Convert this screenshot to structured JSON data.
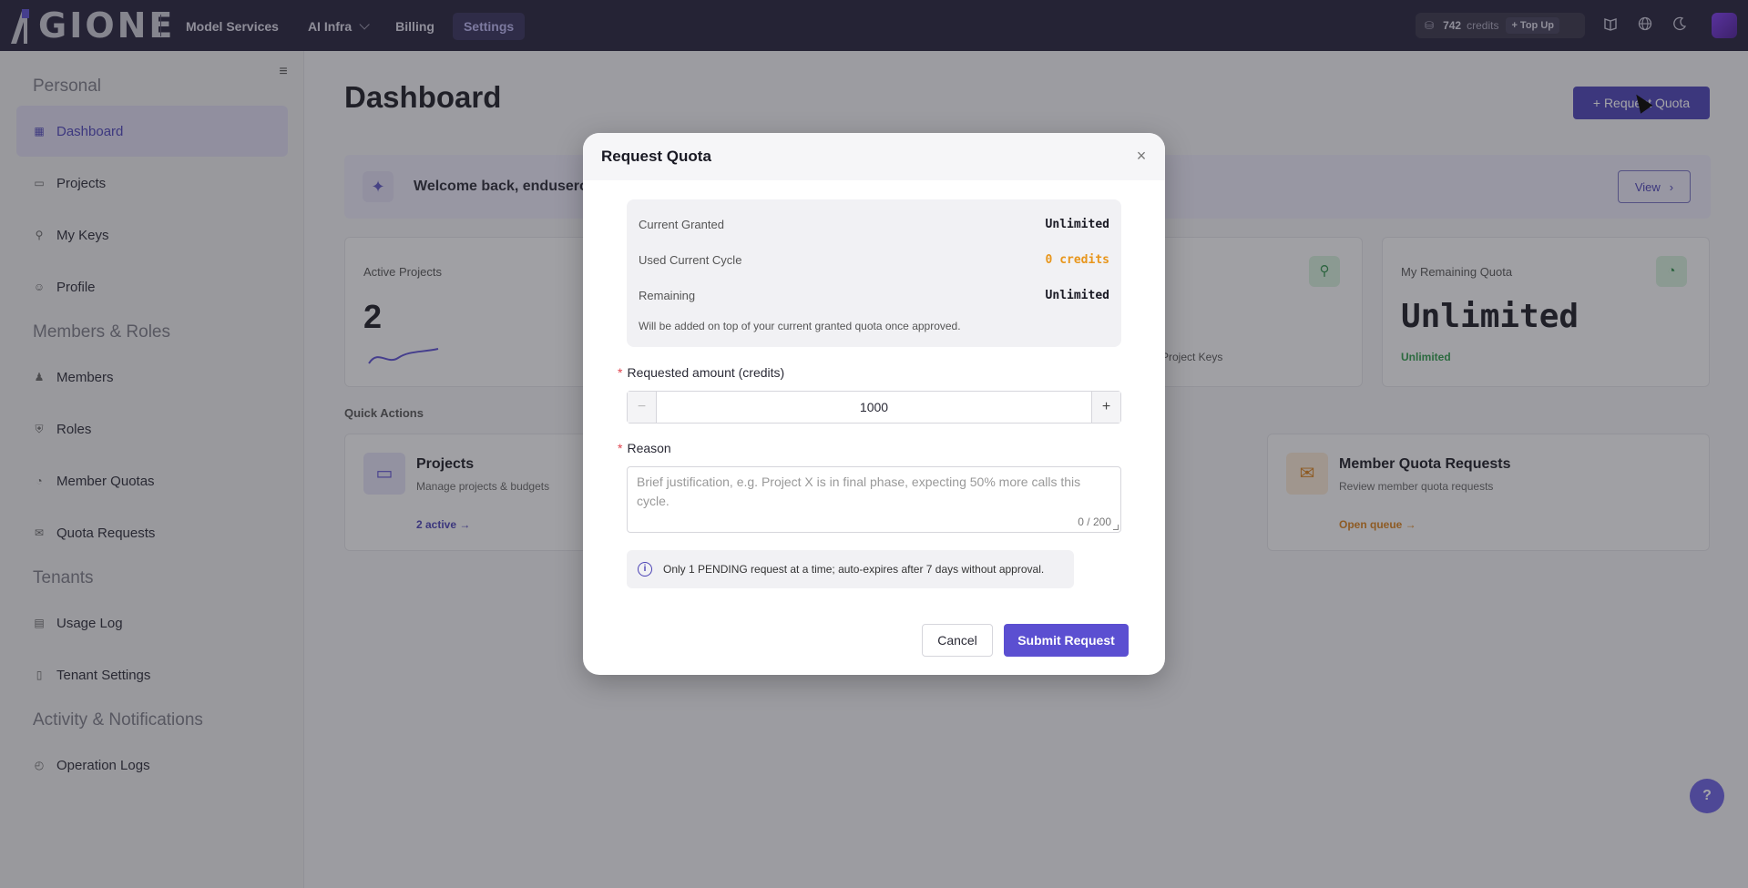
{
  "topbar": {
    "logo_text": "GIONE",
    "nav": [
      {
        "label": "Model Services",
        "active": false
      },
      {
        "label": "AI Infra",
        "active": false,
        "has_dropdown": true
      },
      {
        "label": "Billing",
        "active": false
      },
      {
        "label": "Settings",
        "active": true
      }
    ],
    "credits_value": "742",
    "credits_unit": "credits",
    "topup_label": "+ Top Up",
    "icons": [
      "book-icon",
      "globe-icon",
      "moon-icon"
    ]
  },
  "sidebar": {
    "sections": [
      {
        "title": "Personal",
        "items": [
          {
            "label": "Dashboard",
            "icon": "dashboard-icon",
            "active": true
          },
          {
            "label": "Projects",
            "icon": "folder-icon"
          },
          {
            "label": "My Keys",
            "icon": "key-icon"
          },
          {
            "label": "Profile",
            "icon": "user-circle-icon"
          }
        ]
      },
      {
        "title": "Members & Roles",
        "items": [
          {
            "label": "Members",
            "icon": "users-icon"
          },
          {
            "label": "Roles",
            "icon": "shield-icon"
          },
          {
            "label": "Member Quotas",
            "icon": "gauge-icon"
          },
          {
            "label": "Quota Requests",
            "icon": "inbox-icon"
          }
        ]
      },
      {
        "title": "Tenants",
        "items": [
          {
            "label": "Usage Log",
            "icon": "log-icon"
          },
          {
            "label": "Tenant Settings",
            "icon": "building-icon"
          }
        ]
      },
      {
        "title": "Activity & Notifications",
        "items": [
          {
            "label": "Operation Logs",
            "icon": "history-icon"
          }
        ]
      }
    ]
  },
  "main": {
    "title": "Dashboard",
    "request_quota_label": "+ Request Quota",
    "welcome_text": "Welcome back, enduseron",
    "view_label": "View",
    "cards": [
      {
        "title": "Active Projects",
        "value": "2",
        "sub": ""
      },
      {
        "title": "",
        "value": "",
        "sub": "Project Keys"
      },
      {
        "title": "My Remaining Quota",
        "value": "Unlimited",
        "sub": "Unlimited"
      }
    ],
    "quick_actions_label": "Quick Actions",
    "quick_actions": [
      {
        "title": "Projects",
        "desc": "Manage projects & budgets",
        "link": "2 active →"
      },
      {
        "title": "Member Quota Requests",
        "desc": "Review member quota requests",
        "link": "Open queue →"
      }
    ]
  },
  "modal": {
    "title": "Request Quota",
    "info": [
      {
        "label": "Current Granted",
        "value": "Unlimited"
      },
      {
        "label": "Used Current Cycle",
        "value": "0 credits"
      },
      {
        "label": "Remaining",
        "value": "Unlimited"
      }
    ],
    "info_note": "Will be added on top of your current granted quota once approved.",
    "amount_label": "Requested amount (credits)",
    "amount_value": "1000",
    "reason_label": "Reason",
    "reason_placeholder": "Brief justification, e.g. Project X is in final phase, expecting 50% more calls this cycle.",
    "reason_count": "0 / 200",
    "notice": "Only 1 PENDING request at a time; auto-expires after 7 days without approval.",
    "cancel_label": "Cancel",
    "submit_label": "Submit Request"
  },
  "colors": {
    "accent": "#4b42b5",
    "submit": "#5b4fd1",
    "warning_value": "#e8961c",
    "success": "#2f9a4a"
  }
}
